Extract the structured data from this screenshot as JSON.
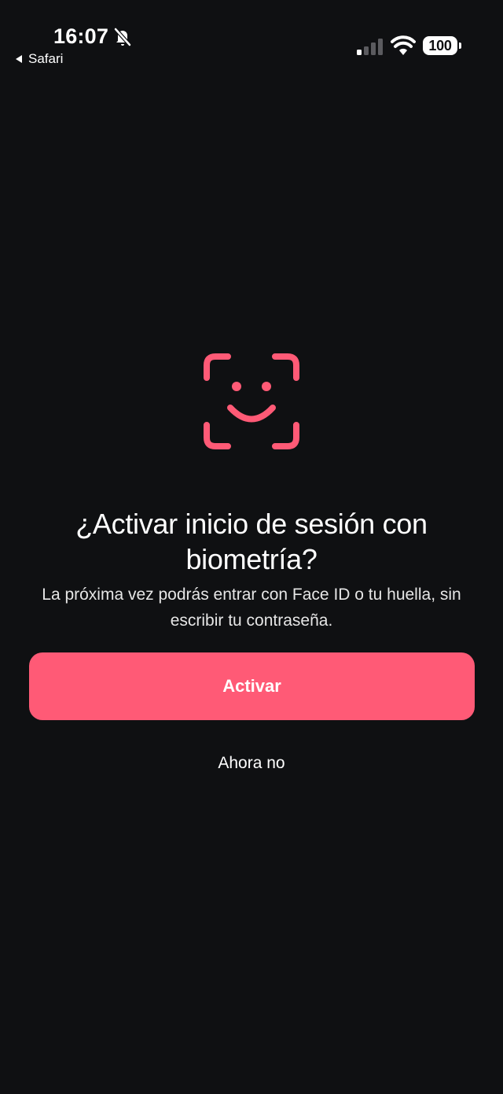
{
  "status_bar": {
    "time": "16:07",
    "battery": "100",
    "back_app": "Safari",
    "icons": [
      "bell-slash-icon",
      "cellular-signal-icon",
      "wifi-icon",
      "battery-icon"
    ],
    "cellular_bars_active": 1,
    "cellular_bars_total": 4
  },
  "biometric_prompt": {
    "icon": "face-id-icon",
    "title": "¿Activar inicio de sesión con biometría?",
    "description": "La próxima vez podrás entrar con Face ID o tu huella, sin escribir tu contraseña.",
    "primary_action": "Activar",
    "secondary_action": "Ahora no"
  },
  "colors": {
    "background": "#0f1012",
    "accent": "#ff5a76",
    "text": "#ffffff",
    "subtitle_text": "#e6e6e6"
  }
}
